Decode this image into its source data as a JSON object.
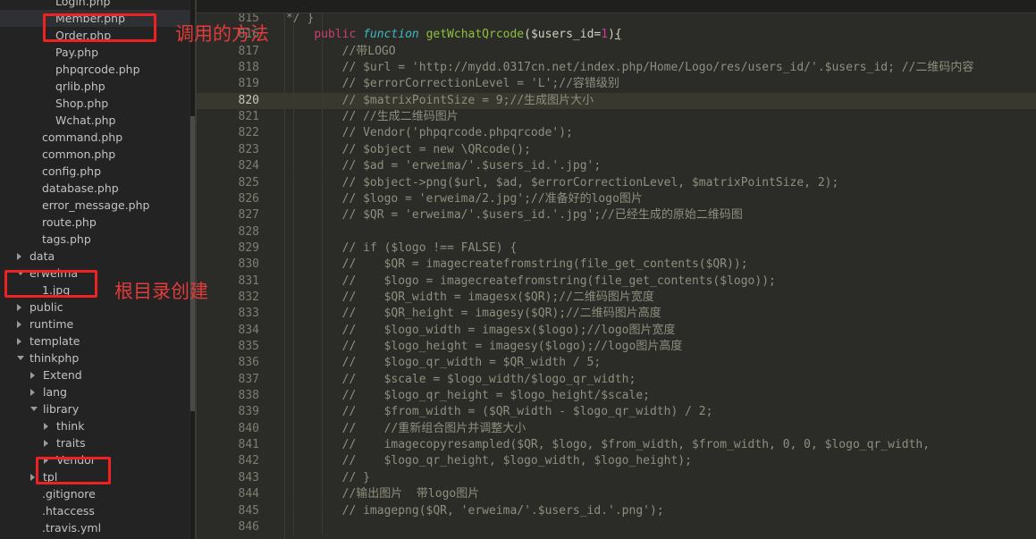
{
  "sidebar": {
    "scrollbar": "vertical-scrollbar",
    "items": [
      {
        "label": "Login.php",
        "indent": 62,
        "twisty": "none",
        "selected": false,
        "clipped": true
      },
      {
        "label": "Member.php",
        "indent": 62,
        "twisty": "none",
        "selected": true,
        "clipped": false
      },
      {
        "label": "Order.php",
        "indent": 62,
        "twisty": "none",
        "selected": false,
        "clipped": false
      },
      {
        "label": "Pay.php",
        "indent": 62,
        "twisty": "none",
        "selected": false,
        "clipped": false
      },
      {
        "label": "phpqrcode.php",
        "indent": 62,
        "twisty": "none",
        "selected": false,
        "clipped": false
      },
      {
        "label": "qrlib.php",
        "indent": 62,
        "twisty": "none",
        "selected": false,
        "clipped": false
      },
      {
        "label": "Shop.php",
        "indent": 62,
        "twisty": "none",
        "selected": false,
        "clipped": false
      },
      {
        "label": "Wchat.php",
        "indent": 62,
        "twisty": "none",
        "selected": false,
        "clipped": false
      },
      {
        "label": "command.php",
        "indent": 47,
        "twisty": "none",
        "selected": false,
        "clipped": false
      },
      {
        "label": "common.php",
        "indent": 47,
        "twisty": "none",
        "selected": false,
        "clipped": false
      },
      {
        "label": "config.php",
        "indent": 47,
        "twisty": "none",
        "selected": false,
        "clipped": false
      },
      {
        "label": "database.php",
        "indent": 47,
        "twisty": "none",
        "selected": false,
        "clipped": false
      },
      {
        "label": "error_message.php",
        "indent": 47,
        "twisty": "none",
        "selected": false,
        "clipped": false
      },
      {
        "label": "route.php",
        "indent": 47,
        "twisty": "none",
        "selected": false,
        "clipped": false
      },
      {
        "label": "tags.php",
        "indent": 47,
        "twisty": "none",
        "selected": false,
        "clipped": false
      },
      {
        "label": "data",
        "indent": 33,
        "twisty": "closed",
        "selected": false,
        "clipped": false
      },
      {
        "label": "erweima",
        "indent": 33,
        "twisty": "open",
        "selected": false,
        "clipped": false
      },
      {
        "label": "1.jpg",
        "indent": 47,
        "twisty": "none",
        "selected": false,
        "clipped": false
      },
      {
        "label": "public",
        "indent": 33,
        "twisty": "closed",
        "selected": false,
        "clipped": false
      },
      {
        "label": "runtime",
        "indent": 33,
        "twisty": "closed",
        "selected": false,
        "clipped": false
      },
      {
        "label": "template",
        "indent": 33,
        "twisty": "closed",
        "selected": false,
        "clipped": false
      },
      {
        "label": "thinkphp",
        "indent": 33,
        "twisty": "open",
        "selected": false,
        "clipped": false
      },
      {
        "label": "Extend",
        "indent": 48,
        "twisty": "closed",
        "selected": false,
        "clipped": false
      },
      {
        "label": "lang",
        "indent": 48,
        "twisty": "closed",
        "selected": false,
        "clipped": false
      },
      {
        "label": "library",
        "indent": 48,
        "twisty": "open",
        "selected": false,
        "clipped": false
      },
      {
        "label": "think",
        "indent": 63,
        "twisty": "closed",
        "selected": false,
        "clipped": false
      },
      {
        "label": "traits",
        "indent": 63,
        "twisty": "closed",
        "selected": false,
        "clipped": false
      },
      {
        "label": "Vendor",
        "indent": 63,
        "twisty": "closed",
        "selected": false,
        "clipped": false
      },
      {
        "label": "tpl",
        "indent": 48,
        "twisty": "closed",
        "selected": false,
        "clipped": false
      },
      {
        "label": ".gitignore",
        "indent": 47,
        "twisty": "none",
        "selected": false,
        "clipped": false
      },
      {
        "label": ".htaccess",
        "indent": 47,
        "twisty": "none",
        "selected": false,
        "clipped": false
      },
      {
        "label": ".travis.yml",
        "indent": 47,
        "twisty": "none",
        "selected": false,
        "clipped": true
      }
    ]
  },
  "annotations": {
    "accent_color": "#e23b3b",
    "box_member_php": {
      "label": "member-php-highlight-box"
    },
    "box_erweima": {
      "label": "erweima-highlight-box"
    },
    "box_vendor": {
      "label": "vendor-highlight-box"
    },
    "text_method": "调用的方法",
    "text_root_dir": "根目录创建"
  },
  "editor": {
    "highlighted_line": 820,
    "first_visible_line": 815,
    "last_visible_line": 846,
    "lines": [
      {
        "no": "815",
        "clipped": true,
        "tokens": [
          {
            "t": "*/ }",
            "c": "t-comment"
          }
        ]
      },
      {
        "no": "816",
        "tokens": [
          {
            "t": "    ",
            "c": "t-punct"
          },
          {
            "t": "public",
            "c": "t-kw"
          },
          {
            "t": " ",
            "c": "t-punct"
          },
          {
            "t": "function",
            "c": "t-fnkw"
          },
          {
            "t": " ",
            "c": "t-punct"
          },
          {
            "t": "getWchatQrcode",
            "c": "t-fname"
          },
          {
            "t": "(",
            "c": "t-punct"
          },
          {
            "t": "$users_id",
            "c": "t-var"
          },
          {
            "t": "=",
            "c": "t-punct"
          },
          {
            "t": "1",
            "c": "t-num"
          },
          {
            "t": ")",
            "c": "t-punct"
          },
          {
            "t": "{",
            "c": "t-brace"
          }
        ]
      },
      {
        "no": "817",
        "tokens": [
          {
            "t": "        //带LOGO",
            "c": "t-comment"
          }
        ]
      },
      {
        "no": "818",
        "tokens": [
          {
            "t": "        // $url = 'http://mydd.0317cn.net/index.php/Home/Logo/res/users_id/'.$users_id; //二维码内容",
            "c": "t-comment"
          }
        ]
      },
      {
        "no": "819",
        "tokens": [
          {
            "t": "        // $errorCorrectionLevel = 'L';//容错级别",
            "c": "t-comment"
          }
        ]
      },
      {
        "no": "820",
        "tokens": [
          {
            "t": "        // $matrixPointSize = 9;//生成图片大小",
            "c": "t-comment"
          }
        ]
      },
      {
        "no": "821",
        "tokens": [
          {
            "t": "        // //生成二维码图片",
            "c": "t-comment"
          }
        ]
      },
      {
        "no": "822",
        "tokens": [
          {
            "t": "        // Vendor('phpqrcode.phpqrcode');",
            "c": "t-comment"
          }
        ]
      },
      {
        "no": "823",
        "tokens": [
          {
            "t": "        // $object = new \\QRcode();",
            "c": "t-comment"
          }
        ]
      },
      {
        "no": "824",
        "tokens": [
          {
            "t": "        // $ad = 'erweima/'.$users_id.'.jpg';",
            "c": "t-comment"
          }
        ]
      },
      {
        "no": "825",
        "tokens": [
          {
            "t": "        // $object->png($url, $ad, $errorCorrectionLevel, $matrixPointSize, 2);",
            "c": "t-comment"
          }
        ]
      },
      {
        "no": "826",
        "tokens": [
          {
            "t": "        // $logo = 'erweima/2.jpg';//准备好的logo图片",
            "c": "t-comment"
          }
        ]
      },
      {
        "no": "827",
        "tokens": [
          {
            "t": "        // $QR = 'erweima/'.$users_id.'.jpg';//已经生成的原始二维码图",
            "c": "t-comment"
          }
        ]
      },
      {
        "no": "828",
        "tokens": [
          {
            "t": "",
            "c": "t-comment"
          }
        ]
      },
      {
        "no": "829",
        "tokens": [
          {
            "t": "        // if ($logo !== FALSE) {",
            "c": "t-comment"
          }
        ]
      },
      {
        "no": "830",
        "tokens": [
          {
            "t": "        //    $QR = imagecreatefromstring(file_get_contents($QR));",
            "c": "t-comment"
          }
        ]
      },
      {
        "no": "831",
        "tokens": [
          {
            "t": "        //    $logo = imagecreatefromstring(file_get_contents($logo));",
            "c": "t-comment"
          }
        ]
      },
      {
        "no": "832",
        "tokens": [
          {
            "t": "        //    $QR_width = imagesx($QR);//二维码图片宽度",
            "c": "t-comment"
          }
        ]
      },
      {
        "no": "833",
        "tokens": [
          {
            "t": "        //    $QR_height = imagesy($QR);//二维码图片高度",
            "c": "t-comment"
          }
        ]
      },
      {
        "no": "834",
        "tokens": [
          {
            "t": "        //    $logo_width = imagesx($logo);//logo图片宽度",
            "c": "t-comment"
          }
        ]
      },
      {
        "no": "835",
        "tokens": [
          {
            "t": "        //    $logo_height = imagesy($logo);//logo图片高度",
            "c": "t-comment"
          }
        ]
      },
      {
        "no": "836",
        "tokens": [
          {
            "t": "        //    $logo_qr_width = $QR_width / 5;",
            "c": "t-comment"
          }
        ]
      },
      {
        "no": "837",
        "tokens": [
          {
            "t": "        //    $scale = $logo_width/$logo_qr_width;",
            "c": "t-comment"
          }
        ]
      },
      {
        "no": "838",
        "tokens": [
          {
            "t": "        //    $logo_qr_height = $logo_height/$scale;",
            "c": "t-comment"
          }
        ]
      },
      {
        "no": "839",
        "tokens": [
          {
            "t": "        //    $from_width = ($QR_width - $logo_qr_width) / 2;",
            "c": "t-comment"
          }
        ]
      },
      {
        "no": "840",
        "tokens": [
          {
            "t": "        //    //重新组合图片并调整大小",
            "c": "t-comment"
          }
        ]
      },
      {
        "no": "841",
        "tokens": [
          {
            "t": "        //    imagecopyresampled($QR, $logo, $from_width, $from_width, 0, 0, $logo_qr_width,",
            "c": "t-comment"
          }
        ]
      },
      {
        "no": "842",
        "tokens": [
          {
            "t": "        //    $logo_qr_height, $logo_width, $logo_height);",
            "c": "t-comment"
          }
        ]
      },
      {
        "no": "843",
        "tokens": [
          {
            "t": "        // }",
            "c": "t-comment"
          }
        ]
      },
      {
        "no": "844",
        "tokens": [
          {
            "t": "        //输出图片  带logo图片",
            "c": "t-comment"
          }
        ]
      },
      {
        "no": "845",
        "tokens": [
          {
            "t": "        // imagepng($QR, 'erweima/'.$users_id.'.png');",
            "c": "t-comment"
          }
        ]
      },
      {
        "no": "846",
        "tokens": [
          {
            "t": "",
            "c": "t-comment"
          }
        ]
      }
    ]
  }
}
